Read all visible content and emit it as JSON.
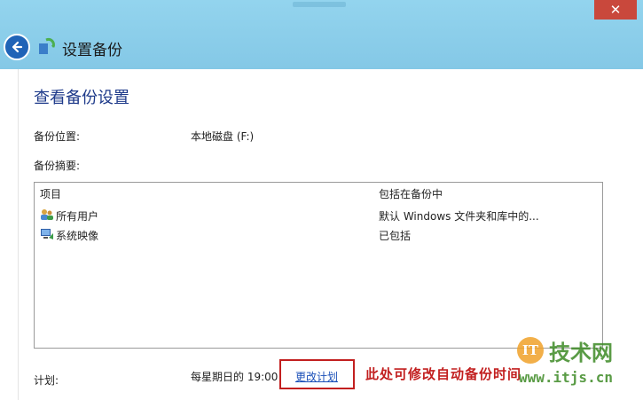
{
  "window": {
    "title": "设置备份",
    "close_glyph": "✕",
    "back_icon": "back-arrow-icon",
    "app_icon": "backup-icon"
  },
  "page": {
    "heading": "查看备份设置"
  },
  "location": {
    "label": "备份位置:",
    "value": "本地磁盘 (F:)"
  },
  "summary": {
    "label": "备份摘要:",
    "columns": [
      "项目",
      "包括在备份中"
    ],
    "rows": [
      {
        "icon": "users-icon",
        "item": "所有用户",
        "included": "默认 Windows 文件夹和库中的..."
      },
      {
        "icon": "system-image-icon",
        "item": "系统映像",
        "included": "已包括"
      }
    ]
  },
  "schedule": {
    "label": "计划:",
    "value": "每星期日的 19:00",
    "change_link": "更改计划"
  },
  "annotation": {
    "text": "此处可修改自动备份时间",
    "color": "#c21f1f"
  },
  "watermark": {
    "badge": "IT",
    "name": "技术网",
    "url": "www.itjs.cn"
  },
  "colors": {
    "titlebar": "#8ecfe9",
    "heading": "#1e3a8a",
    "link": "#1a4fb8",
    "close": "#c9483c"
  }
}
